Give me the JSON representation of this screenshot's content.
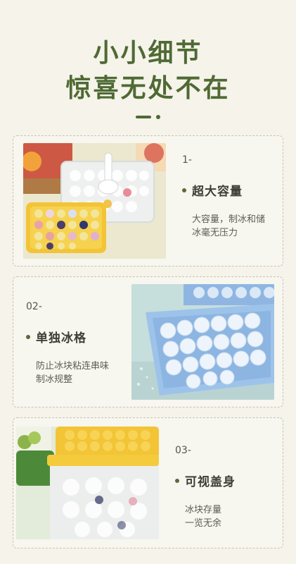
{
  "hero": {
    "line1": "小小细节",
    "line2": "惊喜无处不在"
  },
  "features": [
    {
      "num": "1-",
      "title": "超大容量",
      "desc_line1": "大容量，制冰和储",
      "desc_line2": "冰毫无压力"
    },
    {
      "num": "02-",
      "title": "单独冰格",
      "desc_line1": "防止冰块粘连串味",
      "desc_line2": "制冰规整"
    },
    {
      "num": "03-",
      "title": "可视盖身",
      "desc_line1": "冰块存量",
      "desc_line2": "一览无余"
    }
  ],
  "colors": {
    "background": "#f5f3ea",
    "accent_green": "#4f6a34",
    "card_border": "#c9c4b3",
    "tray_yellow": "#f2c436",
    "tray_blue": "#9ec3ea"
  }
}
